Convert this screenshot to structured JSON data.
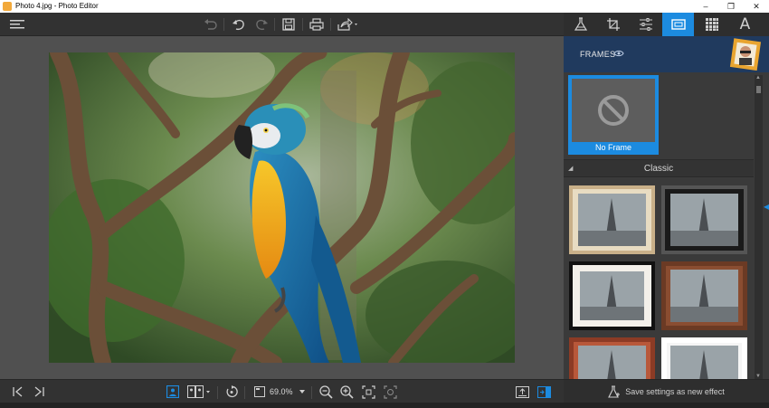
{
  "window": {
    "title": "Photo 4.jpg - Photo Editor",
    "minimize_icon": "minimize-icon",
    "restore_icon": "restore-icon",
    "close_icon": "close-icon"
  },
  "toolbar": {
    "menu_icon": "hamburger-menu-icon",
    "buttons": [
      "revert-icon",
      "undo-icon",
      "redo-icon",
      "save-icon",
      "print-icon",
      "share-icon"
    ]
  },
  "right_tabs": {
    "items": [
      "effects-flask-icon",
      "crop-icon",
      "adjust-sliders-icon",
      "frames-icon",
      "texture-grid-icon",
      "text-icon"
    ],
    "active": "frames-icon",
    "text_tab_label": "A"
  },
  "frames_panel": {
    "title": "FRAMES",
    "no_frame_label": "No Frame",
    "section_title": "Classic",
    "thumbnails": [
      {
        "frame": "beige mat"
      },
      {
        "frame": "black wood"
      },
      {
        "frame": "white mat black"
      },
      {
        "frame": "brown wood"
      },
      {
        "frame": "red wood"
      },
      {
        "frame": "white"
      }
    ]
  },
  "bottombar": {
    "zoom_value": "69.0%",
    "buttons": [
      "first-image-icon",
      "next-image-icon",
      "single-view-icon",
      "compare-view-icon",
      "rotate-icon",
      "zoom-out-icon",
      "zoom-in-icon",
      "fit-icon",
      "actual-size-icon",
      "export-icon",
      "panel-toggle-icon"
    ]
  },
  "save_effect": {
    "label": "Save settings as new effect"
  },
  "colors": {
    "accent": "#1c8be0",
    "panel": "#3a3a3a",
    "toolbar": "#323232",
    "canvas": "#505050"
  }
}
